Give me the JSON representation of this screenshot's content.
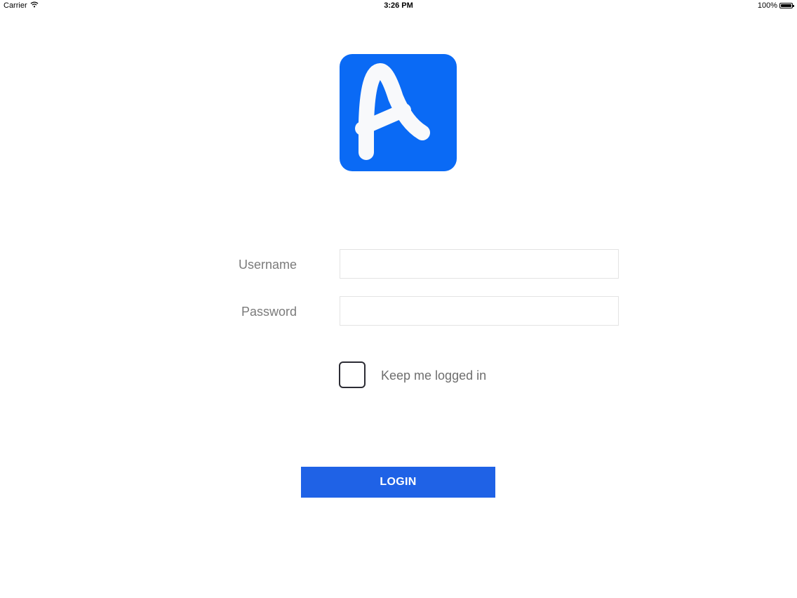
{
  "status_bar": {
    "carrier": "Carrier",
    "time": "3:26 PM",
    "battery": "100%",
    "battery_level": 1.0,
    "icons": [
      "wifi-icon",
      "battery-icon"
    ]
  },
  "logo": {
    "letter": "A",
    "background_color": "#0a6af5"
  },
  "form": {
    "username": {
      "label": "Username",
      "value": "",
      "placeholder": ""
    },
    "password": {
      "label": "Password",
      "value": "",
      "placeholder": ""
    },
    "keep_logged_in": {
      "label": "Keep me logged in",
      "checked": false
    },
    "login_button": {
      "label": "LOGIN",
      "color": "#1f62e6"
    }
  }
}
